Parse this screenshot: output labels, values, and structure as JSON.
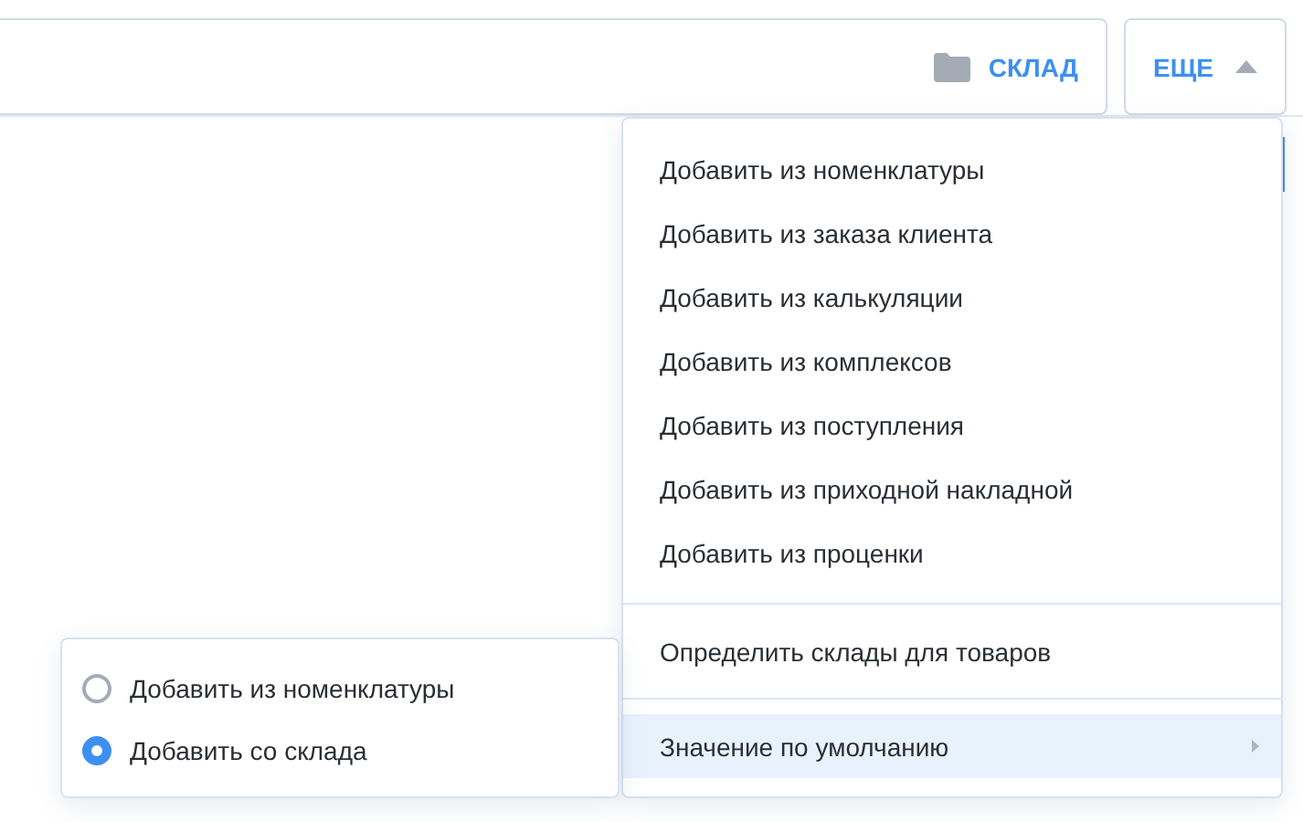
{
  "toolbar": {
    "warehouse_button": {
      "label": "СКЛАД"
    },
    "more_button": {
      "label": "ЕЩЕ",
      "expanded": true
    }
  },
  "menu": {
    "groups": [
      {
        "items": [
          {
            "label": "Добавить из номенклатуры",
            "kind": "action",
            "expanded": false
          },
          {
            "label": "Добавить из заказа клиента",
            "kind": "action",
            "expanded": false
          },
          {
            "label": "Добавить из калькуляции",
            "kind": "action",
            "expanded": false
          },
          {
            "label": "Добавить из комплексов",
            "kind": "action",
            "expanded": false
          },
          {
            "label": "Добавить из поступления",
            "kind": "action",
            "expanded": false
          },
          {
            "label": "Добавить из приходной накладной",
            "kind": "action",
            "expanded": false
          },
          {
            "label": "Добавить из проценки",
            "kind": "action",
            "expanded": false
          }
        ]
      },
      {
        "items": [
          {
            "label": "Определить склады для товаров",
            "kind": "action",
            "expanded": false
          }
        ]
      },
      {
        "items": [
          {
            "label": "Значение по умолчанию",
            "kind": "submenu",
            "expanded": true
          }
        ]
      }
    ]
  },
  "submenu": {
    "options": [
      {
        "label": "Добавить из номенклатуры",
        "selected": false
      },
      {
        "label": "Добавить со склада",
        "selected": true
      }
    ]
  }
}
